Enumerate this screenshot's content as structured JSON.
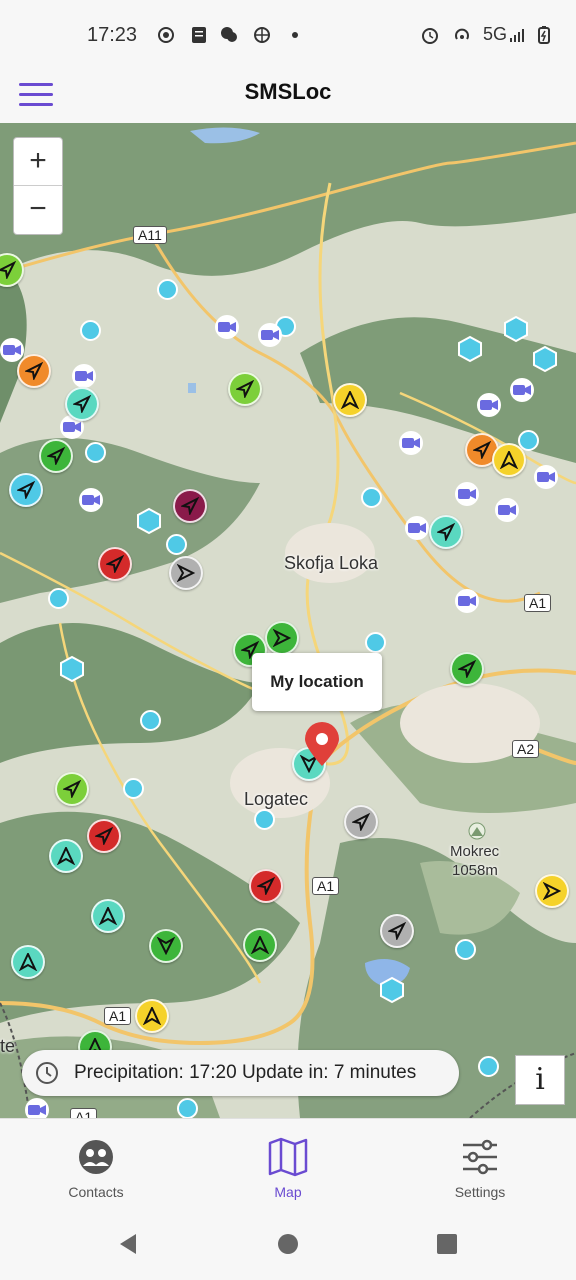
{
  "status_bar": {
    "time": "17:23",
    "network": "5G",
    "icons": [
      "record-icon",
      "document-icon",
      "chat-icon",
      "globe-icon",
      "dot-icon",
      "alarm-icon",
      "hotspot-icon",
      "signal-icon",
      "battery-icon"
    ]
  },
  "app_bar": {
    "title": "SMSLoc",
    "menu_icon": "hamburger-menu-icon"
  },
  "map": {
    "zoom_in": "+",
    "zoom_out": "−",
    "road_labels": [
      "A11",
      "A1",
      "A2",
      "A1",
      "A1",
      "A1"
    ],
    "place_labels": [
      "Skofja Loka",
      "Logatec",
      "Mokrec",
      "1058m",
      "te"
    ],
    "popup": "My location",
    "colors": {
      "green": "#7ccf3a",
      "dark_green": "#3db53a",
      "teal": "#5ad8c0",
      "cyan": "#4fc9e6",
      "red": "#d42a2a",
      "orange": "#f08a2a",
      "yellow": "#f5d22a",
      "gray": "#b0b0b0",
      "maroon": "#8a1a4a",
      "pin": "#e0403a"
    }
  },
  "precipitation": {
    "text": "Precipitation: 17:20 Update in: 7 minutes",
    "icon": "clock-icon"
  },
  "info_button": "i",
  "bottom_nav": {
    "items": [
      {
        "label": "Contacts",
        "icon": "contacts-icon",
        "active": false
      },
      {
        "label": "Map",
        "icon": "map-icon",
        "active": true
      },
      {
        "label": "Settings",
        "icon": "sliders-icon",
        "active": false
      }
    ],
    "accent": "#6a4bd1"
  },
  "system_nav": [
    "back-icon",
    "home-icon",
    "recents-icon"
  ]
}
